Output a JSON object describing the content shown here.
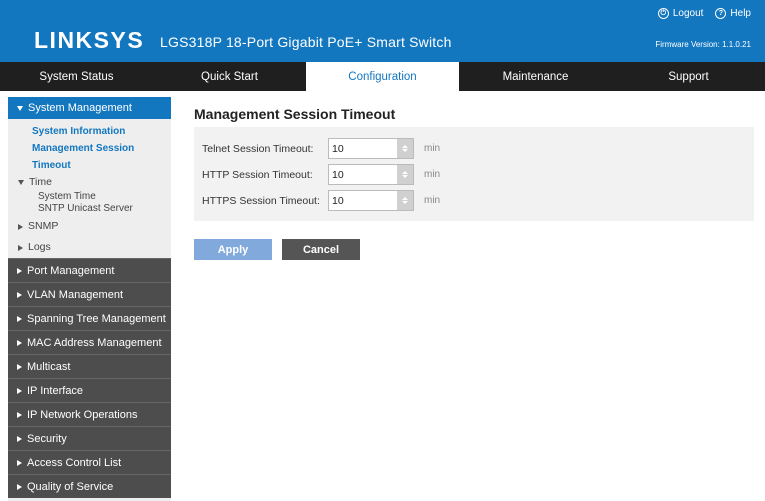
{
  "header": {
    "brand": "LINKSYS",
    "product": "LGS318P 18-Port Gigabit PoE+ Smart Switch",
    "logout": "Logout",
    "help": "Help",
    "firmware": "Firmware Version: 1.1.0.21"
  },
  "nav": {
    "tabs": [
      {
        "label": "System Status"
      },
      {
        "label": "Quick Start"
      },
      {
        "label": "Configuration"
      },
      {
        "label": "Maintenance"
      },
      {
        "label": "Support"
      }
    ]
  },
  "sidebar": {
    "active_section": "System Management",
    "sub_items": [
      "System Information",
      "Management Session Timeout"
    ],
    "time_group": "Time",
    "time_items": [
      "System Time",
      "SNTP Unicast Server"
    ],
    "snmp": "SNMP",
    "logs": "Logs",
    "sections": [
      "Port Management",
      "VLAN Management",
      "Spanning Tree Management",
      "MAC Address Management",
      "Multicast",
      "IP Interface",
      "IP Network Operations",
      "Security",
      "Access Control List",
      "Quality of Service"
    ]
  },
  "main": {
    "title": "Management Session Timeout",
    "fields": [
      {
        "label": "Telnet Session Timeout:",
        "value": "10",
        "unit": "min"
      },
      {
        "label": "HTTP Session Timeout:",
        "value": "10",
        "unit": "min"
      },
      {
        "label": "HTTPS Session Timeout:",
        "value": "10",
        "unit": "min"
      }
    ],
    "apply_label": "Apply",
    "cancel_label": "Cancel"
  },
  "colors": {
    "brand_blue": "#1377c0",
    "nav_dark": "#1f1f1f",
    "sidebar_dark": "#4d4d4d",
    "apply_button": "#82a9dc",
    "cancel_button": "#555555"
  },
  "icons": {
    "logout": "power-icon",
    "help": "question-icon"
  }
}
